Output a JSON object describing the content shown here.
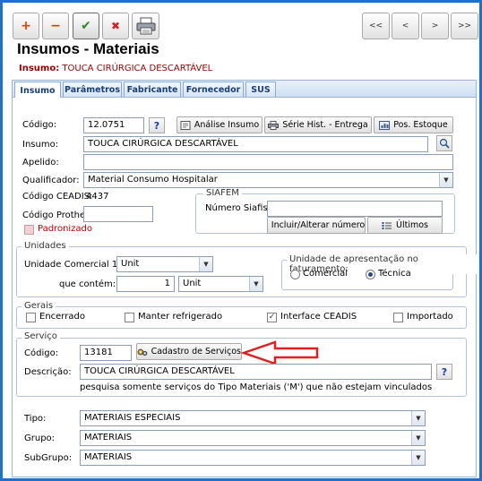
{
  "toolbar": {
    "add": "+",
    "remove": "−",
    "confirm": "✔",
    "cancel": "✖",
    "first": "<<",
    "prev": "<",
    "next": ">",
    "last": ">>"
  },
  "header": {
    "title": "Insumos - Materiais",
    "subtitle_label": "Insumo:",
    "subtitle_value": "TOUCA CIRÚRGICA DESCARTÁVEL"
  },
  "tabs": [
    "Insumo",
    "Parâmetros",
    "Fabricante",
    "Fornecedor",
    "SUS"
  ],
  "insumo": {
    "codigo_label": "Código:",
    "codigo_value": "12.0751",
    "analise_btn": "Análise Insumo",
    "serie_btn": "Série Hist. - Entrega",
    "pos_btn": "Pos. Estoque",
    "insumo_label": "Insumo:",
    "insumo_value": "TOUCA CIRÚRGICA DESCARTÁVEL",
    "apelido_label": "Apelido:",
    "apelido_value": "",
    "qualificador_label": "Qualificador:",
    "qualificador_value": "Material Consumo Hospitalar",
    "ceadis_label": "Código CEADIS:",
    "ceadis_value": "4437",
    "protheus_label": "Código Protheus:",
    "protheus_value": "",
    "padronizado_label": "Padronizado"
  },
  "siafem": {
    "legend": "SIAFEM",
    "numero_label": "Número Siafisico:",
    "numero_value": "",
    "incluir_btn": "Incluir/Alterar número",
    "ultimos_btn": "Últimos"
  },
  "unidades": {
    "legend": "Unidades",
    "comercial_label": "Unidade Comercial 1:",
    "comercial_value": "Unit",
    "contem_label": "que contém:",
    "contem_value": "1",
    "contem_unit": "Unit",
    "apresentacao_legend": "Unidade de apresentação no faturamento:",
    "opt_comercial": "Comercial",
    "opt_tecnica": "Técnica"
  },
  "gerais": {
    "legend": "Gerais",
    "encerrado": "Encerrado",
    "refrigerado": "Manter refrigerado",
    "interface": "Interface CEADIS",
    "importado": "Importado"
  },
  "servico": {
    "legend": "Serviço",
    "codigo_label": "Código:",
    "codigo_value": "13181",
    "cadastro_btn": "Cadastro de Serviços",
    "descricao_label": "Descrição:",
    "descricao_value": "TOUCA CIRÚRGICA DESCARTÁVEL",
    "hint": "pesquisa somente serviços do Tipo Materiais ('M') que não estejam vinculados a outros"
  },
  "classificacao": {
    "tipo_label": "Tipo:",
    "tipo_value": "MATERIAIS ESPECIAIS",
    "grupo_label": "Grupo:",
    "grupo_value": "MATERIAIS",
    "subgrupo_label": "SubGrupo:",
    "subgrupo_value": "MATERIAIS"
  },
  "colors": {
    "frame": "#1f6fd0",
    "subtitle": "#9a0000",
    "arrow": "#e02020",
    "add_icon": "#e03b00",
    "confirm_icon": "#2a8a2a"
  }
}
